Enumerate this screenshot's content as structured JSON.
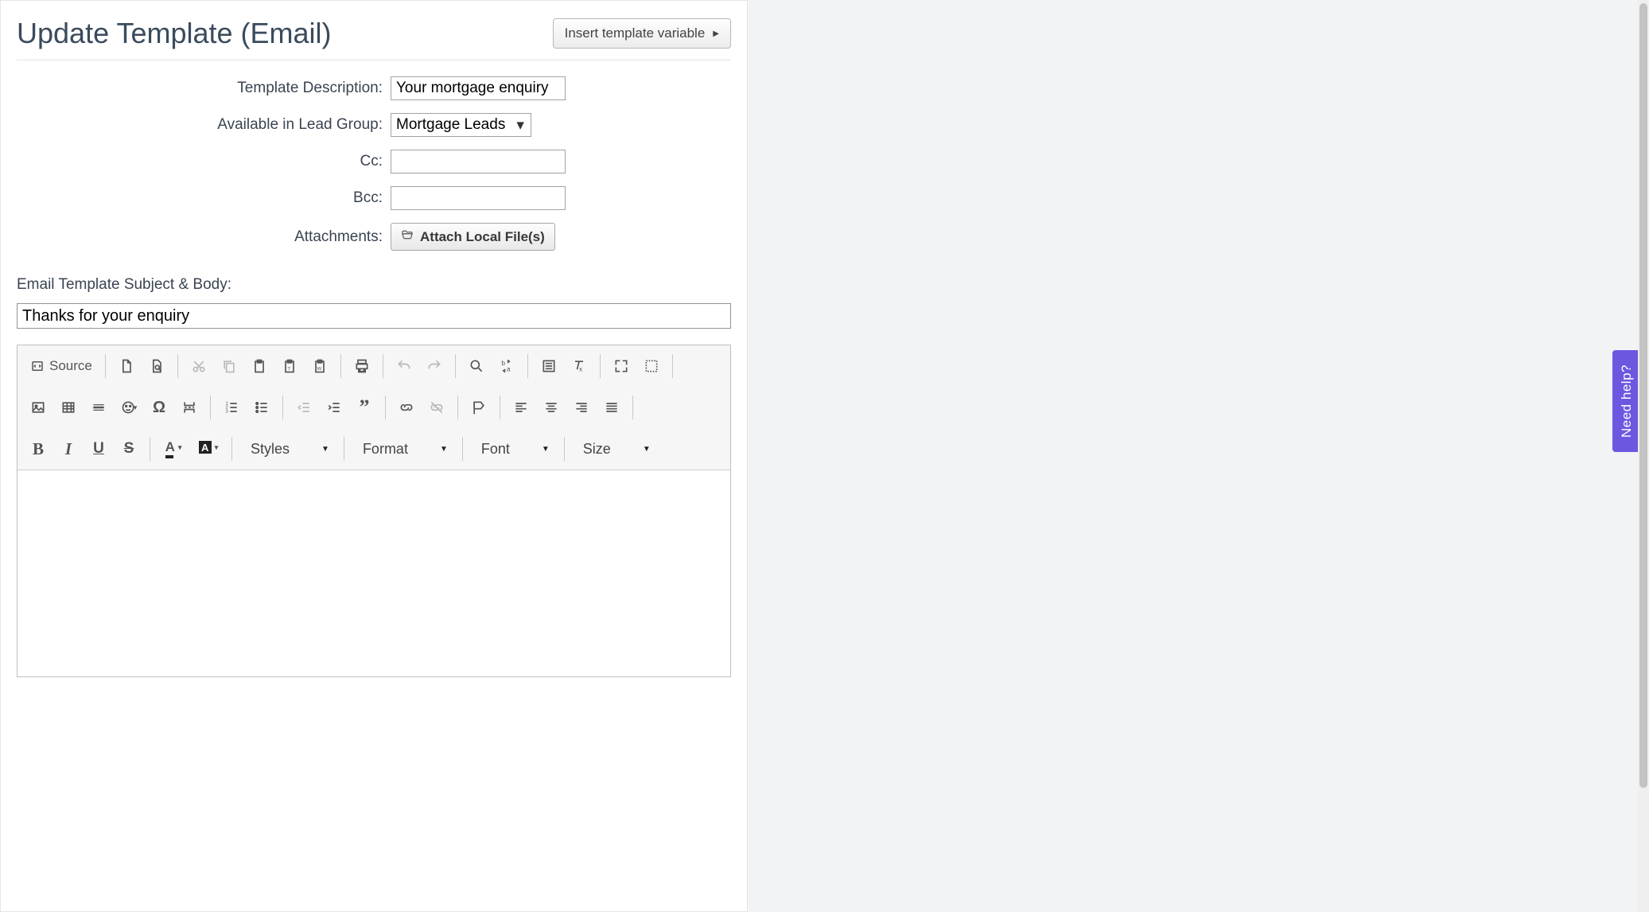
{
  "page": {
    "title": "Update Template (Email)",
    "insert_variable_btn": "Insert template variable"
  },
  "form": {
    "description_label": "Template Description:",
    "description_value": "Your mortgage enquiry",
    "lead_group_label": "Available in Lead Group:",
    "lead_group_value": "Mortgage Leads",
    "cc_label": "Cc:",
    "cc_value": "",
    "bcc_label": "Bcc:",
    "bcc_value": "",
    "attachments_label": "Attachments:",
    "attach_btn": "Attach Local File(s)"
  },
  "subject": {
    "section_label": "Email Template Subject & Body:",
    "value": "Thanks for your enquiry"
  },
  "toolbar": {
    "source": "Source",
    "styles": "Styles",
    "format": "Format",
    "font": "Font",
    "size": "Size"
  },
  "help_tab": "Need help?"
}
